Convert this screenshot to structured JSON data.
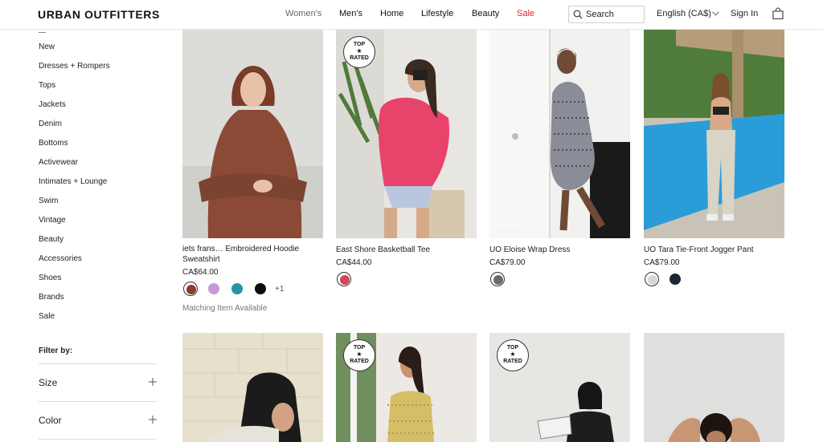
{
  "header": {
    "logo": "URBAN OUTFITTERS",
    "nav": [
      "Women's",
      "Men's",
      "Home",
      "Lifestyle",
      "Beauty",
      "Sale"
    ],
    "search_label": "Search",
    "language": "English (CA$)",
    "signin": "Sign In"
  },
  "sidebar": {
    "categories": [
      "New",
      "Dresses + Rompers",
      "Tops",
      "Jackets",
      "Denim",
      "Bottoms",
      "Activewear",
      "Intimates + Lounge",
      "Swim",
      "Vintage",
      "Beauty",
      "Accessories",
      "Shoes",
      "Brands",
      "Sale"
    ],
    "filter_title": "Filter by:",
    "filters": [
      "Size",
      "Color"
    ]
  },
  "products": [
    {
      "name_line1": "iets frans… Embroidered Hoodie",
      "name_line2": "Sweatshirt",
      "price": "CA$64.00",
      "swatches": [
        "#8a3f26",
        "#c79ad4",
        "#2a93a9",
        "#0d0d0d"
      ],
      "more_colors": "+1",
      "matching": "Matching Item Available",
      "top_rated": false
    },
    {
      "name_line1": "East Shore Basketball Tee",
      "price": "CA$44.00",
      "swatches": [
        "#d24753"
      ],
      "top_rated": true
    },
    {
      "name_line1": "UO Eloise Wrap Dress",
      "price": "CA$79.00",
      "swatches": [
        "#6a6a6a"
      ],
      "top_rated": false,
      "watermark": "@miaghagna"
    },
    {
      "name_line1": "UO Tara Tie-Front Jogger Pant",
      "price": "CA$79.00",
      "swatches": [
        "#d9d7cf",
        "#1f2633"
      ],
      "top_rated": false
    },
    {
      "top_rated": false
    },
    {
      "top_rated": true
    },
    {
      "top_rated": true
    },
    {
      "top_rated": false
    }
  ],
  "badge": {
    "line1": "TOP",
    "star": "★",
    "line2": "RATED"
  },
  "colors": {
    "sale": "#e0232e",
    "border": "#e6e6e6"
  }
}
